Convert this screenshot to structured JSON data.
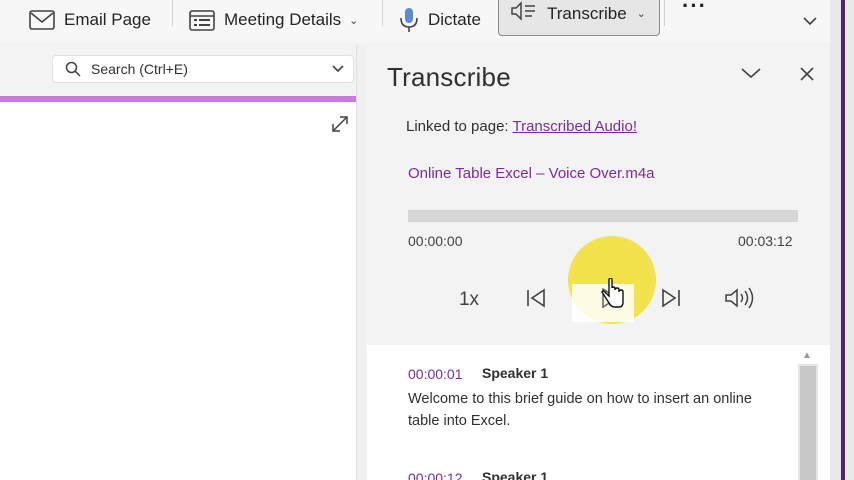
{
  "ribbon": {
    "email_page_label": "Email Page",
    "meeting_details_label": "Meeting Details",
    "dictate_label": "Dictate",
    "transcribe_label": "Transcribe",
    "more_label": "···"
  },
  "search": {
    "placeholder": "Search (Ctrl+E)"
  },
  "pane": {
    "title": "Transcribe",
    "linked_prefix": "Linked to page: ",
    "linked_page": "Transcribed Audio!",
    "file_name": "Online Table Excel – Voice Over.m4a",
    "time_start": "00:00:00",
    "time_end": "00:03:12",
    "progress": 0,
    "speed": "1x"
  },
  "transcript": [
    {
      "time": "00:00:01",
      "speaker": "Speaker 1",
      "text": "Welcome to this brief guide on how to insert an online table into Excel."
    },
    {
      "time": "00:00:12",
      "speaker": "Speaker 1",
      "text": ""
    }
  ],
  "colors": {
    "accent": "#7b2c9c",
    "tab_bar": "#c77de0",
    "cursor_highlight": "#f2e03a"
  }
}
